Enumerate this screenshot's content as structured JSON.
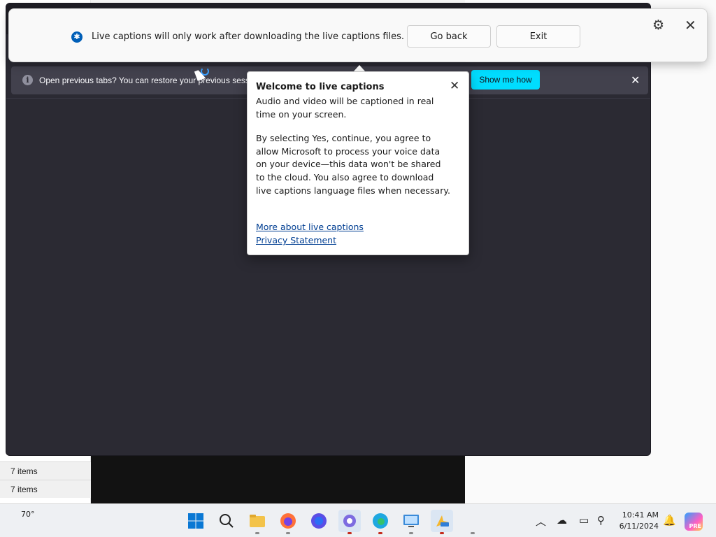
{
  "captions_bar": {
    "message": "Live captions will only work after downloading the live captions files.",
    "go_back_label": "Go back",
    "exit_label": "Exit"
  },
  "browser": {
    "infobar": {
      "bold_text": "Open previous tabs?",
      "text": "You can restore your previous sessi",
      "button_label": "Show me how"
    }
  },
  "popup": {
    "title": "Welcome to live captions",
    "paragraph1": "Audio and video will be captioned in real time on your screen.",
    "paragraph2": "By selecting Yes, continue, you agree to allow Microsoft to process your voice data on your device—this data won't be shared to the cloud. You also agree to download live captions language files when necessary.",
    "link1": "More about live captions",
    "link2": "Privacy Statement"
  },
  "background": {
    "list_item_1": "7 items",
    "list_item_2": "7 items"
  },
  "taskbar": {
    "weather": "70°",
    "time": "10:41 AM",
    "date": "6/11/2024",
    "copilot_badge": "PRE"
  }
}
